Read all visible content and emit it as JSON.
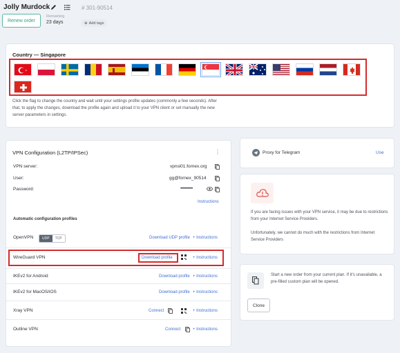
{
  "header": {
    "title": "Jolly Murdock",
    "order_id": "# 301-90514",
    "renew_label": "Renew order",
    "remaining_label": "Remaining",
    "remaining_value": "23 days",
    "add_tags_label": "Add tags"
  },
  "country": {
    "title": "Country — Singapore",
    "selected": "singapore",
    "flags": [
      "turkey",
      "poland",
      "sweden",
      "romania",
      "spain",
      "estonia",
      "france",
      "germany",
      "singapore",
      "united-kingdom",
      "australia",
      "usa",
      "russia",
      "netherlands",
      "canada",
      "switzerland"
    ],
    "description": "Click the flag to change the country and wait until your settings profile updates (commonly a few seconds). After that, to apply the changes, download the profile again and upload it to your VPN client or set manually the new server parameters in settings."
  },
  "vpn": {
    "title": "VPN Configuration (L2TP/IPSec)",
    "menu_icon": "⋮",
    "server_label": "VPN server:",
    "server_value": "vpnsi01.fornex.org",
    "user_label": "User:",
    "user_value": "gg@fornex_90514",
    "password_label": "Password:",
    "password_value": "••••••••••",
    "instructions_label": "Instructions",
    "auto_title": "Automatic configuration profiles",
    "rows": [
      {
        "name": "OpenVPN",
        "action": "Download UDP profile",
        "instructions": "+ Instructions"
      },
      {
        "name": "WireGuard VPN",
        "action": "Download profile",
        "instructions": "+ Instructions"
      },
      {
        "name": "IKEv2 for Android",
        "action": "Download profile",
        "instructions": "+ Instructions"
      },
      {
        "name": "IKEv2 for MacOS/iOS",
        "action": "Download profile",
        "instructions": "+ Instructions"
      },
      {
        "name": "Xray VPN",
        "action": "Connect",
        "instructions": "+ Instructions"
      },
      {
        "name": "Outline VPN",
        "action": "Connect",
        "instructions": "+ Instructions"
      }
    ],
    "udp_label": "UDP",
    "tcp_label": "TCP"
  },
  "telegram": {
    "label": "Proxy for Telegram",
    "use_label": "Use"
  },
  "warning": {
    "text1": "If you are facing issues with your VPN service, it may be due to restrictions from your Internet Service Providers.",
    "text2": "Unfortunately, we cannot do much with the restrictions from Internet Service Providers"
  },
  "clone": {
    "text": "Start a new order from your current plan. If it's unavailable, a pre-filled custom plan will be opened.",
    "button_label": "Clone"
  },
  "colors": {
    "accent": "#3e6fd1",
    "highlight": "#d42a2a",
    "renew": "#3b9a82"
  }
}
